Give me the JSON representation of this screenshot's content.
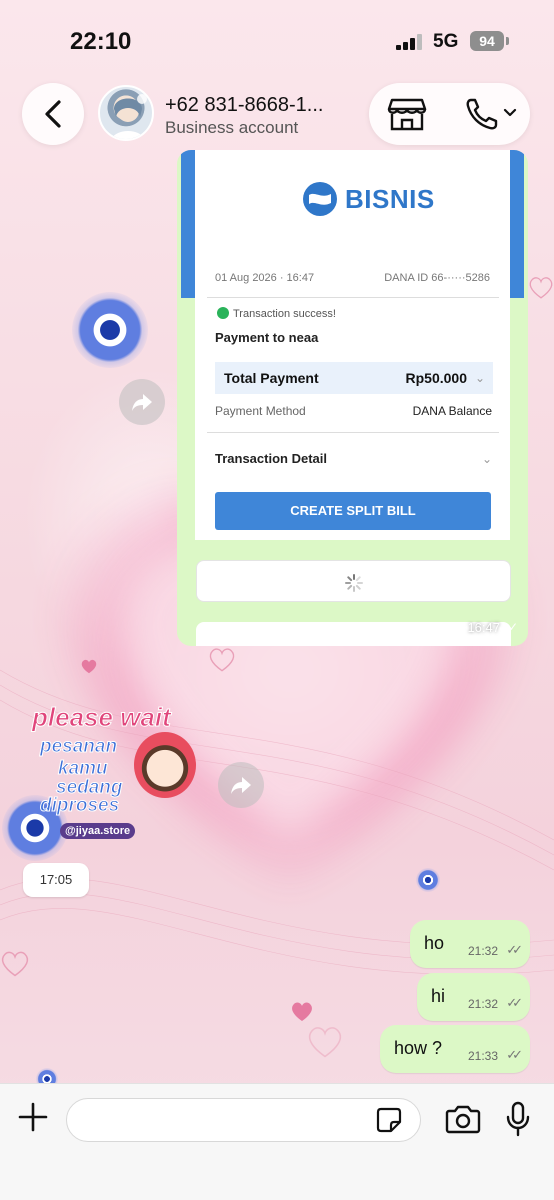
{
  "status_bar": {
    "time": "22:10",
    "network": "5G",
    "battery": "94"
  },
  "header": {
    "contact_name": "+62 831-8668-1...",
    "contact_subtitle": "Business account",
    "icons": [
      "back-chevron-icon",
      "store-icon",
      "phone-icon",
      "chevron-down-icon"
    ]
  },
  "receipt": {
    "brand": "BISNIS",
    "date_time": "01 Aug 2026 · 16:47",
    "dana_id": "DANA ID 66-·····5286",
    "status": "Transaction success!",
    "payment_to": "Payment to neaa",
    "total_label": "Total Payment",
    "total_value": "Rp50.000",
    "method_label": "Payment Method",
    "method_value": "DANA Balance",
    "detail_label": "Transaction Detail",
    "button_label": "CREATE SPLIT BILL",
    "message_time": "16:47"
  },
  "sticker": {
    "line1": "please wait",
    "line2": "pesanan",
    "line3": "kamu",
    "line4": "sedang",
    "line5": "diproses",
    "handle": "@jiyaa.store"
  },
  "time_chip": "17:05",
  "messages": [
    {
      "text": "ho",
      "time": "21:32",
      "status": "read"
    },
    {
      "text": "hi",
      "time": "21:32",
      "status": "read"
    },
    {
      "text": "how ?",
      "time": "21:33",
      "status": "read"
    }
  ],
  "composer": {
    "placeholder": "",
    "icons": [
      "plus-icon",
      "sticker-icon",
      "camera-icon",
      "microphone-icon"
    ]
  },
  "colors": {
    "bubble_out": "#dcf8c6",
    "dana_blue": "#3f86d8",
    "wallpaper_pink": "#f6dde3"
  }
}
